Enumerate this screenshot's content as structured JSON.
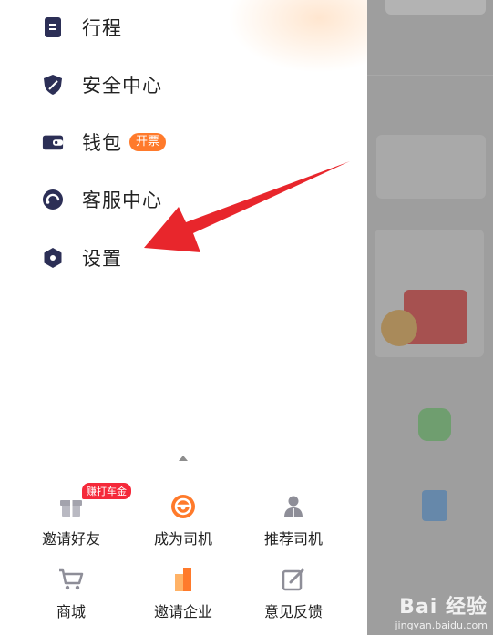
{
  "menu": {
    "items": [
      {
        "label": "行程",
        "icon": "itinerary-icon"
      },
      {
        "label": "安全中心",
        "icon": "shield-icon"
      },
      {
        "label": "钱包",
        "icon": "wallet-icon",
        "badge": "开票"
      },
      {
        "label": "客服中心",
        "icon": "customer-service-icon"
      },
      {
        "label": "设置",
        "icon": "settings-icon"
      }
    ]
  },
  "grid": {
    "items": [
      {
        "label": "邀请好友",
        "icon": "gift-icon",
        "tag": "赚打车金"
      },
      {
        "label": "成为司机",
        "icon": "steering-wheel-icon"
      },
      {
        "label": "推荐司机",
        "icon": "driver-icon"
      },
      {
        "label": "商城",
        "icon": "cart-icon"
      },
      {
        "label": "邀请企业",
        "icon": "building-icon"
      },
      {
        "label": "意见反馈",
        "icon": "feedback-icon"
      }
    ]
  },
  "watermark": {
    "main": "Bai 经验",
    "sub": "jingyan.baidu.com"
  },
  "colors": {
    "accent_orange": "#ff7a2b",
    "icon_dark": "#2c2f56",
    "tag_red": "#f5293a",
    "annotation_red": "#e8262c"
  }
}
